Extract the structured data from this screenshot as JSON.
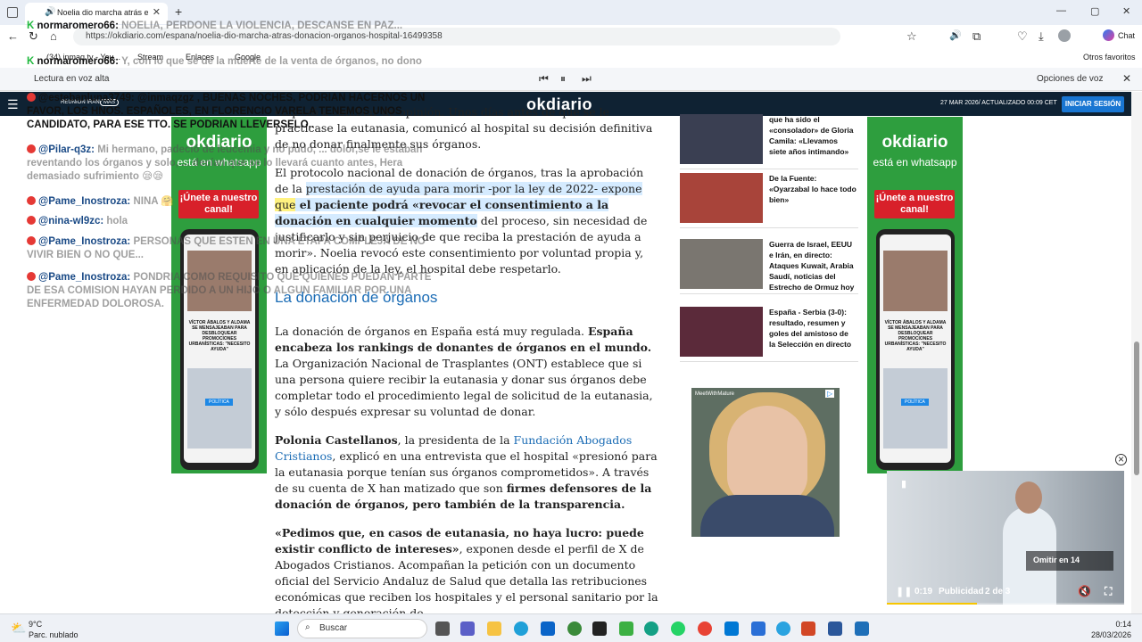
{
  "browser": {
    "tab_title": "Noelia dio marcha atrás en la",
    "url": "https://okdiario.com/espana/noelia-dio-marcha-atras-donacion-organos-hospital-16499358",
    "favorites": [
      "(34) inmaq tv - You...",
      "Stream",
      "Enlaces",
      "Google"
    ],
    "other_favorites": "Otros favoritos",
    "read_aloud": "Lectura en voz alta",
    "voice_options": "Opciones de voz",
    "chat_label": "Chat"
  },
  "site": {
    "logo": "okdiario",
    "section_label": "REUNIÓN IRÁN",
    "more_label": "MÁS",
    "date": "27 MAR 2026/ ACTUALIZADO 00:09 CET",
    "login": "INICIAR SESIÓN"
  },
  "article": {
    "p1": "empezó a cambiar de opinión. Unos días antes de que se le practicase la eutanasia, comunicó al hospital su decisión definitiva de no donar finalmente sus órganos.",
    "p2_a": "El protocolo nacional de donación de órganos, tras la aprobación de la ",
    "p2_hl": "prestación de ayuda para morir -por la ley de 2022- expone ",
    "p2_yl": "que",
    "p2_b": " el paciente podrá «revocar el consentimiento a la donación en cualquier momento",
    "p2_c": " del proceso, sin necesidad de justificarlo y sin perjuicio de que reciba la prestación de ayuda a morir». Noelia revocó este consentimiento por voluntad propia y, en aplicación de la ley, el hospital debe respetarlo.",
    "h2": "La donación de órganos",
    "p3_a": "La donación de órganos en España está muy regulada. ",
    "p3_b": "España encabeza los rankings de donantes de órganos en el mundo.",
    "p3_c": " La Organización Nacional de Trasplantes (ONT) establece que si una persona quiere recibir la eutanasia y donar sus órganos debe completar todo el procedimiento legal de solicitud de la eutanasia, y sólo después expresar su voluntad de donar.",
    "p4_a": "Polonia Castellanos",
    "p4_b": ", la presidenta de la ",
    "p4_link": "Fundación Abogados Cristianos",
    "p4_c": ", explicó en una entrevista que el hospital «presionó para la eutanasia porque tenían sus órganos comprometidos». A través de su cuenta de X han matizado que son ",
    "p4_d": "firmes defensores de la donación de órganos, pero también de la transparencia.",
    "p5_a": "«Pedimos que, en casos de eutanasia, no haya lucro: puede existir conflicto de intereses»",
    "p5_b": ", exponen desde el perfil de X de Abogados Cristianos. Acompañan la petición con un documento oficial del Servicio Andaluz de Salud que detalla las retribuciones económicas que reciben los hospitales y el personal sanitario por la detección y generación de"
  },
  "ads": {
    "brand": "okdiario",
    "sub": "está en whatsapp",
    "cta": "¡Únete a nuestro canal!",
    "phone_text": "VÍCTOR ÁBALOS Y ALDAMA SE MENSAJEABAN PARA DESBLOQUEAR PROMOCIONES URBANÍSTICAS: \"NECESITO AYUDA\"",
    "phone_tag": "POLÍTICA",
    "bottom_ad_label": "MeetWithMature"
  },
  "news": [
    {
      "title": "que ha sido el «consolador» de Gloria Camila: «Llevamos siete años intimando»"
    },
    {
      "title": "De la Fuente: «Oyarzabal lo hace todo bien»"
    },
    {
      "title": "Guerra de Israel, EEUU e Irán, en directo: Ataques Kuwait, Arabia Saudí, noticias del Estrecho de Ormuz hoy"
    },
    {
      "title": "España - Serbia (3-0): resultado, resumen y goles del amistoso de la Selección en directo"
    }
  ],
  "chat": [
    {
      "user": "normaromero66:",
      "msg": "NOELIA, PERDONE LA VIOLENCIA, DESCANSE EN PAZ...",
      "kind": "k"
    },
    {
      "user": "normaromero66:",
      "msg": "Y, con lo que se de la muerte de la venta de órganos, no dono",
      "kind": "k"
    },
    {
      "user": "@estebanluna3749:",
      "msg": "@inmaqzgz , BUENAS NOCHES, PODRIAN HACERNOS UN FAVOR, LOS HNOS. ESPAÑOLES, EN FLORENCIO VARELA TENEMOS UNOS CANDIDATO, PARA ESE TTO. SE PODRIAN LLEVERSELO..",
      "kind": "y"
    },
    {
      "user": "@Pilar-q3z:",
      "msg": "Mi hermano, padeció de leucemia y no pudo, ... dolor,se le estaban reventando los órganos y solo, ... decían que se lo llevará cuanto antes, Hera demasiado sufrimiento 😪😪",
      "kind": "y"
    },
    {
      "user": "@Pame_Inostroza:",
      "msg": "NINA 🤗",
      "kind": "y"
    },
    {
      "user": "@nina-wl9zc:",
      "msg": "hola",
      "kind": "y"
    },
    {
      "user": "@Pame_Inostroza:",
      "msg": "PERSONAS QUE ESTEN EN UNA ETAPA COMPLEJA DE NO VIVIR BIEN O NO QUE...",
      "kind": "y"
    },
    {
      "user": "@Pame_Inostroza:",
      "msg": "PONDRIA COMO REQUISITO QUE QUIENES PUEDAN PARTE DE ESA COMISION HAYAN PERDIDO A UN HIJO O ALGUN FAMILIAR POR UNA ENFERMEDAD DOLOROSA.",
      "kind": "y"
    }
  ],
  "video": {
    "skip": "Omitir en 14",
    "time": "0:19",
    "label": "Publicidad",
    "count": "2 de 3"
  },
  "taskbar": {
    "temp": "9°C",
    "weather": "Parc. nublado",
    "search": "Buscar",
    "time": "0:14",
    "date": "28/03/2026"
  }
}
